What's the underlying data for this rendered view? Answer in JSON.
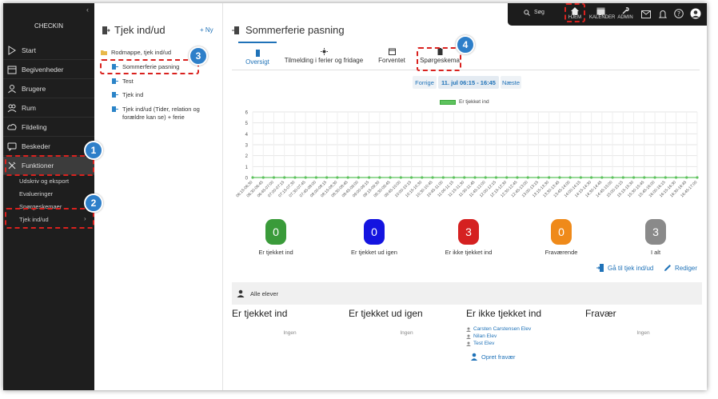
{
  "topbar": {
    "search_label": "Søg",
    "home_label": "HJEM",
    "calendar_label": "KALENDER",
    "admin_label": "ADMIN"
  },
  "sidebar": {
    "brand": "CHECKIN",
    "items": [
      {
        "label": "Start",
        "icon": "play-icon"
      },
      {
        "label": "Begivenheder",
        "icon": "calendar-icon"
      },
      {
        "label": "Brugere",
        "icon": "user-icon"
      },
      {
        "label": "Rum",
        "icon": "room-icon"
      },
      {
        "label": "Fildeling",
        "icon": "cloud-icon"
      },
      {
        "label": "Beskeder",
        "icon": "chat-icon"
      },
      {
        "label": "Funktioner",
        "icon": "tools-icon"
      }
    ],
    "sub_items": [
      "Udskriv og eksport",
      "Evalueringer",
      "Spørgeskemaer",
      "Tjek ind/ud"
    ]
  },
  "middle": {
    "title": "Tjek ind/ud",
    "new_label": "+ Ny",
    "root_folder": "Rodmappe, tjek ind/ud",
    "items": [
      "Sommerferie pasning",
      "Test",
      "Tjek ind",
      "Tjek ind/ud (Tider, relation og forældre kan se) + ferie"
    ]
  },
  "main": {
    "title": "Sommerferie pasning",
    "tabs": [
      {
        "label": "Oversigt",
        "icon": "door-icon"
      },
      {
        "label": "Tilmelding i ferier og fridage",
        "icon": "sun-icon"
      },
      {
        "label": "Forventet",
        "icon": "calendar-icon"
      },
      {
        "label": "Spørgeskema",
        "icon": "clipboard-icon"
      }
    ],
    "nav": {
      "prev": "Forrige",
      "date": "11. jul 06:15 - 16:45",
      "next": "Næste"
    },
    "stats": [
      {
        "value": "0",
        "label": "Er tjekket ind",
        "color": "#3a9b3a"
      },
      {
        "value": "0",
        "label": "Er tjekket ud igen",
        "color": "#1414e0"
      },
      {
        "value": "3",
        "label": "Er ikke tjekket ind",
        "color": "#d52121"
      },
      {
        "value": "0",
        "label": "Fraværende",
        "color": "#ef8a1a"
      },
      {
        "value": "3",
        "label": "I alt",
        "color": "#8a8a8a"
      }
    ],
    "actions": {
      "goto": "Gå til tjek ind/ud",
      "edit": "Rediger"
    },
    "students_header": "Alle elever",
    "columns": [
      {
        "heading": "Er tjekket ind",
        "none": "Ingen"
      },
      {
        "heading": "Er tjekket ud igen",
        "none": "Ingen"
      },
      {
        "heading": "Er ikke tjekket ind",
        "names": [
          "Carsten Carstensen Elev",
          "Nilan Elev",
          "Test Elev"
        ],
        "create_absence": "Opret fravær"
      },
      {
        "heading": "Fravær",
        "none": "Ingen"
      }
    ]
  },
  "chart_data": {
    "type": "line",
    "title": "",
    "xlabel": "",
    "ylabel": "",
    "ylim": [
      0,
      6
    ],
    "yticks": [
      "0",
      "1",
      "2",
      "3",
      "4",
      "5",
      "6"
    ],
    "grid": true,
    "legend_position": "top-center",
    "x": [
      "06:15-06:30",
      "06:30-06:45",
      "06:45-07:00",
      "07:00-07:15",
      "07:15-07:30",
      "07:30-07:45",
      "07:45-08:00",
      "08:00-08:15",
      "08:15-08:30",
      "08:30-08:45",
      "08:45-09:00",
      "09:00-09:15",
      "09:15-09:30",
      "09:30-09:45",
      "09:45-10:00",
      "10:00-10:15",
      "10:15-10:30",
      "10:30-10:45",
      "10:45-11:00",
      "11:00-11:15",
      "11:15-11:30",
      "11:30-11:45",
      "11:45-12:00",
      "12:00-12:15",
      "12:15-12:30",
      "12:30-12:45",
      "12:45-13:00",
      "13:00-13:15",
      "13:15-13:30",
      "13:30-13:45",
      "13:45-14:00",
      "14:00-14:15",
      "14:15-14:30",
      "14:30-14:45",
      "14:45-15:00",
      "15:00-15:15",
      "15:15-15:30",
      "15:30-15:45",
      "15:45-16:00",
      "16:00-16:15",
      "16:15-16:30",
      "16:30-16:45",
      "16:45-17:00"
    ],
    "series": [
      {
        "name": "Er tjekket ind",
        "color": "#5ec35e",
        "values": [
          0,
          0,
          0,
          0,
          0,
          0,
          0,
          0,
          0,
          0,
          0,
          0,
          0,
          0,
          0,
          0,
          0,
          0,
          0,
          0,
          0,
          0,
          0,
          0,
          0,
          0,
          0,
          0,
          0,
          0,
          0,
          0,
          0,
          0,
          0,
          0,
          0,
          0,
          0,
          0,
          0,
          0,
          0
        ]
      }
    ]
  },
  "callouts": [
    "1",
    "2",
    "3",
    "4"
  ]
}
